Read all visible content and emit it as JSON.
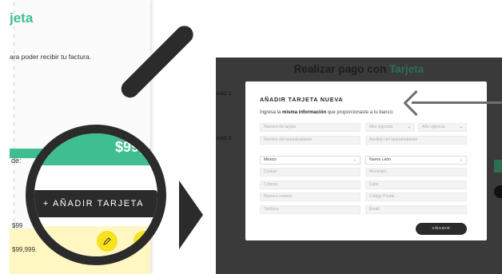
{
  "left_panel": {
    "title_fragment": "jeta",
    "subtitle_fragment": "ara poder recibir tu factura.",
    "label_fragment": "de:",
    "amount_1": "$99",
    "amount_2": "$99,999."
  },
  "lens": {
    "price_fragment": "$99,9",
    "add_card_button": "+ AÑADIR TARJETA"
  },
  "right_shot": {
    "title_prefix": "Realizar pago con",
    "title_accent": "Tarjeta",
    "step_1": "ASO 2",
    "step_2": "ASO 3",
    "modal": {
      "title": "AÑADIR TARJETA NUEVA",
      "desc_prefix": "Ingresa la",
      "desc_bold": "misma información",
      "desc_suffix": "que proporcionaste a tu banco:",
      "placeholders": {
        "card_number": "Número de tarjeta",
        "expiry_month": "Mes vigencia",
        "expiry_year": "Año vigencia",
        "cardholder_name": "Nombre del tarjetahabiente",
        "cardholder_surname": "Apellido del tarjetahabiente",
        "city": "Ciudad",
        "municipality": "Municipio",
        "neighborhood": "Colonia",
        "street": "Calle",
        "exterior_number": "Numero exterior",
        "postal_code": "Código Postal",
        "phone": "Teléfono",
        "email": "Email"
      },
      "country_value": "México",
      "state_value": "Nuevo León",
      "submit_button": "AÑADIR"
    }
  },
  "colors": {
    "accent_green": "#3fbf8f",
    "dark": "#2b2b2b",
    "overlay": "#3a3a3a",
    "highlight_yellow": "#fff7c2"
  }
}
